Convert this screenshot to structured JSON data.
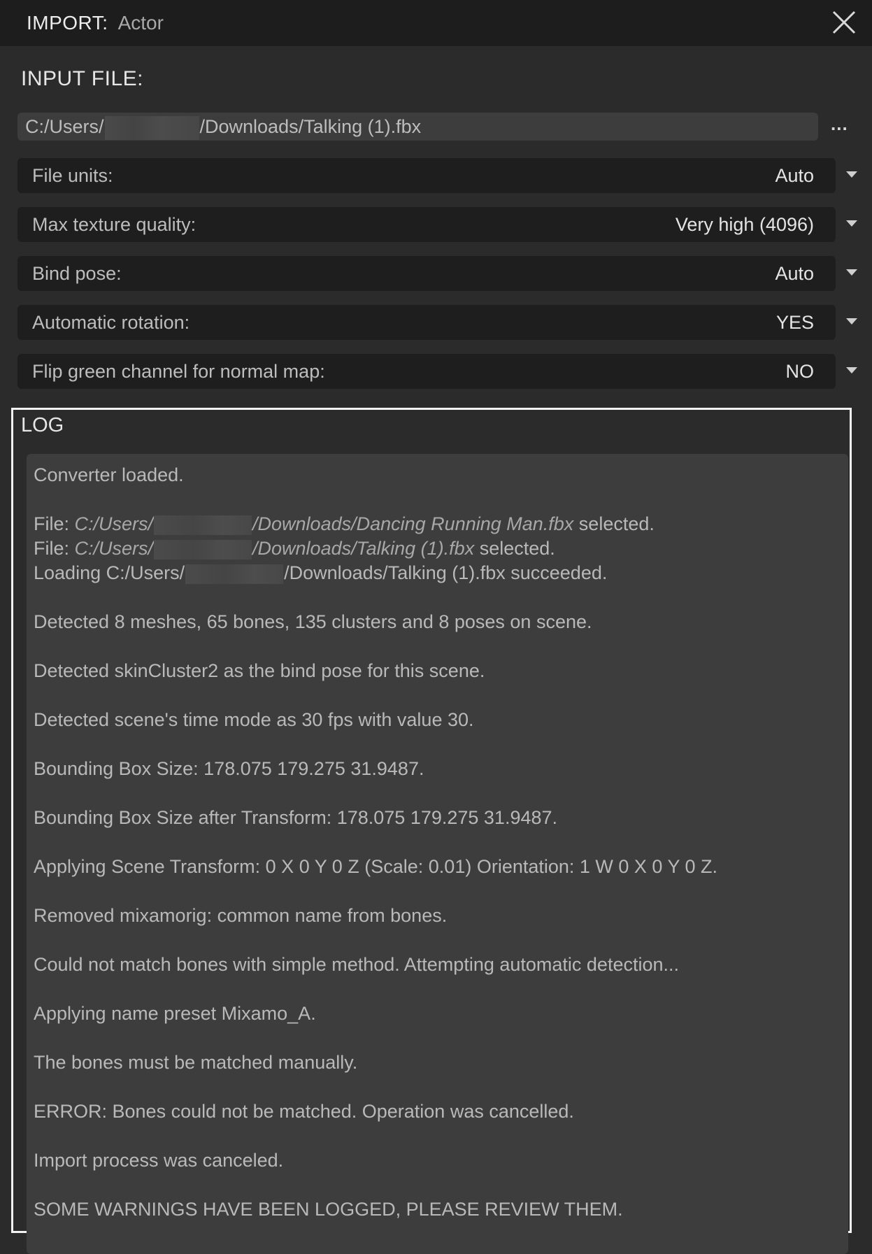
{
  "window": {
    "title_label": "IMPORT:",
    "title_value": "Actor"
  },
  "input_file": {
    "section_label": "INPUT FILE:",
    "path_prefix": "C:/Users/",
    "path_suffix": "/Downloads/Talking (1).fbx",
    "browse_label": "..."
  },
  "options": [
    {
      "label": "File units:",
      "value": "Auto"
    },
    {
      "label": "Max texture quality:",
      "value": "Very high (4096)"
    },
    {
      "label": "Bind pose:",
      "value": "Auto"
    },
    {
      "label": "Automatic rotation:",
      "value": "YES"
    },
    {
      "label": "Flip green channel for normal map:",
      "value": "NO"
    }
  ],
  "log": {
    "title": "LOG",
    "converter_loaded": "Converter loaded.",
    "file_lines": [
      {
        "prefix": "File: ",
        "path_start": "C:/Users/",
        "path_end": "/Downloads/Dancing Running Man.fbx",
        "suffix": " selected."
      },
      {
        "prefix": "File: ",
        "path_start": "C:/Users/",
        "path_end": "/Downloads/Talking (1).fbx",
        "suffix": " selected."
      }
    ],
    "loading_line": {
      "prefix": "Loading C:/Users/",
      "suffix": "/Downloads/Talking (1).fbx succeeded."
    },
    "messages": [
      "Detected 8 meshes, 65 bones, 135 clusters and 8 poses on scene.",
      "Detected skinCluster2 as the bind pose for this scene.",
      "Detected scene's time mode as 30 fps with value 30.",
      "Bounding Box Size: 178.075 179.275 31.9487.",
      "Bounding Box Size after Transform: 178.075 179.275 31.9487.",
      "Applying Scene Transform: 0 X 0 Y 0 Z (Scale: 0.01) Orientation: 1 W 0 X 0 Y 0 Z.",
      "Removed mixamorig: common name from bones.",
      "Could not match bones with simple method. Attempting automatic detection...",
      "Applying name preset Mixamo_A.",
      "The bones must be matched manually.",
      "ERROR: Bones could not be matched. Operation was cancelled.",
      "Import process was canceled.",
      "SOME WARNINGS HAVE BEEN LOGGED, PLEASE REVIEW THEM."
    ]
  }
}
